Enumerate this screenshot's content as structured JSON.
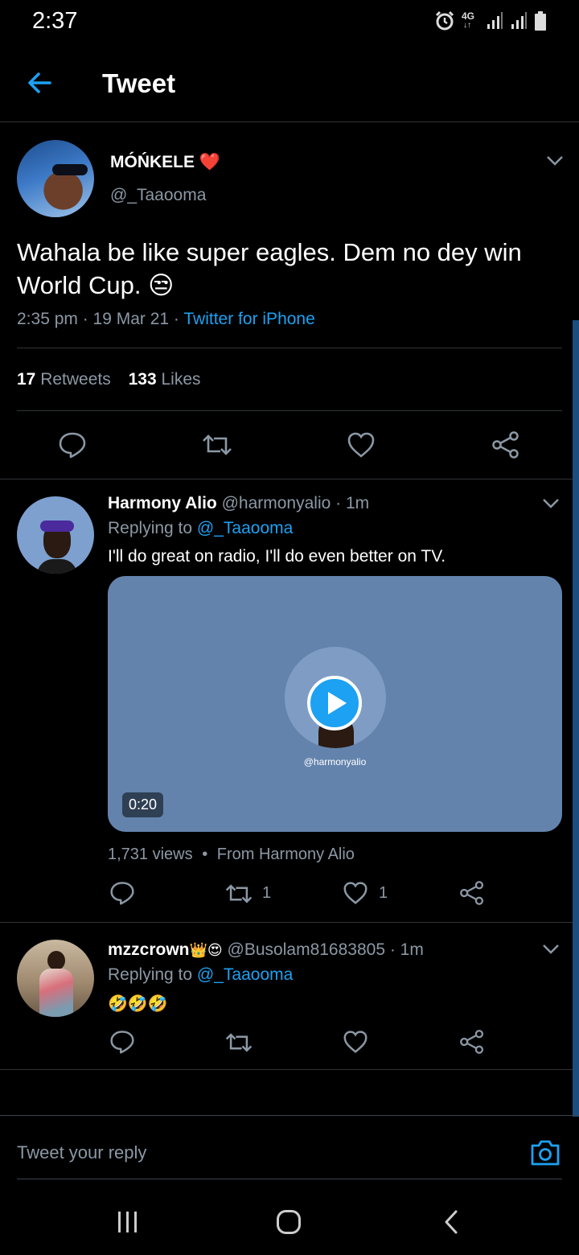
{
  "status_bar": {
    "time": "2:37",
    "network_label": "4G",
    "icons": [
      "alarm-icon",
      "network-4g-icon",
      "signal-icon",
      "signal-icon",
      "battery-icon"
    ]
  },
  "header": {
    "back_icon": "arrow-left-icon",
    "title": "Tweet"
  },
  "main_tweet": {
    "author_name": "MÓŃKELE",
    "author_emoji": "❤️",
    "handle": "@_Taaooma",
    "text_line1": "Wahala be like super eagles. Dem no dey win",
    "text_line2": "World Cup.",
    "text_emoji": "😒",
    "timestamp": "2:35 pm · 19 Mar 21 · ",
    "source": "Twitter for iPhone",
    "retweets_count": "17",
    "retweets_label": "Retweets",
    "likes_count": "133",
    "likes_label": "Likes",
    "actions": [
      "reply-icon",
      "retweet-icon",
      "like-icon",
      "share-icon"
    ]
  },
  "replies": [
    {
      "author_name": "Harmony Alio",
      "handle_time": "@harmonyalio · 1m",
      "replying_prefix": "Replying to ",
      "replying_to": "@_Taaooma",
      "text": "I'll do great on radio, I'll do even better on TV.",
      "video": {
        "watermark": "@harmonyalio",
        "duration": "0:20",
        "views": "1,731 views",
        "from": "From Harmony Alio"
      },
      "retweet_count": "1",
      "like_count": "1"
    },
    {
      "author_name": "mzzcrown",
      "author_emojis": "👑😍",
      "handle_time": "@Busolam81683805 · 1m",
      "replying_prefix": "Replying to ",
      "replying_to": "@_Taaooma",
      "text": "🤣🤣🤣"
    }
  ],
  "reply_bar": {
    "placeholder": "Tweet your reply",
    "camera_icon": "camera-icon"
  },
  "nav_bar": [
    "recents-icon",
    "home-icon",
    "back-icon"
  ],
  "colors": {
    "accent": "#1da1f2",
    "background": "#000000",
    "secondary_text": "#8b98a5",
    "divider": "#2f3336",
    "video_bg": "#6383ad",
    "heart": "#e0245e"
  }
}
